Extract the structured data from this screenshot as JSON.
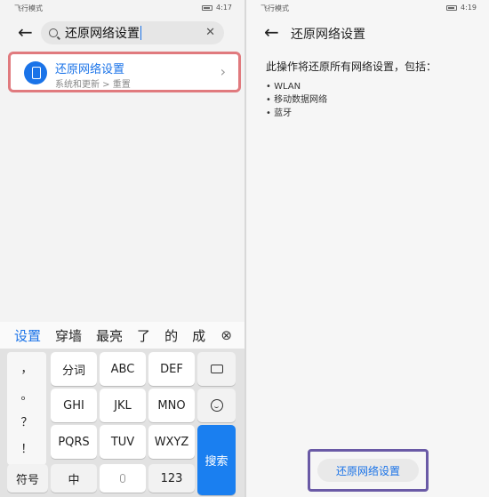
{
  "left": {
    "status": {
      "mode": "飞行模式",
      "time": "4:17"
    },
    "search": {
      "query": "还原网络设置"
    },
    "result": {
      "title": "还原网络设置",
      "path": "系统和更新 > 重置"
    },
    "candidates": [
      "设置",
      "穿墙",
      "最亮",
      "了",
      "的",
      "成"
    ],
    "keyboard": {
      "punct": [
        "，",
        "。",
        "？",
        "！"
      ],
      "row1": [
        "分词",
        "ABC",
        "DEF"
      ],
      "row2": [
        "GHI",
        "JKL",
        "MNO"
      ],
      "row3": [
        "PQRS",
        "TUV",
        "WXYZ"
      ],
      "bottom": {
        "symbols": "符号",
        "chinese": "中",
        "numbers": "123",
        "search": "搜索"
      }
    }
  },
  "right": {
    "status": {
      "mode": "飞行模式",
      "time": "4:19"
    },
    "title": "还原网络设置",
    "description": "此操作将还原所有网络设置，包括：",
    "items": [
      "WLAN",
      "移动数据网络",
      "蓝牙"
    ],
    "reset_button": "还原网络设置"
  }
}
